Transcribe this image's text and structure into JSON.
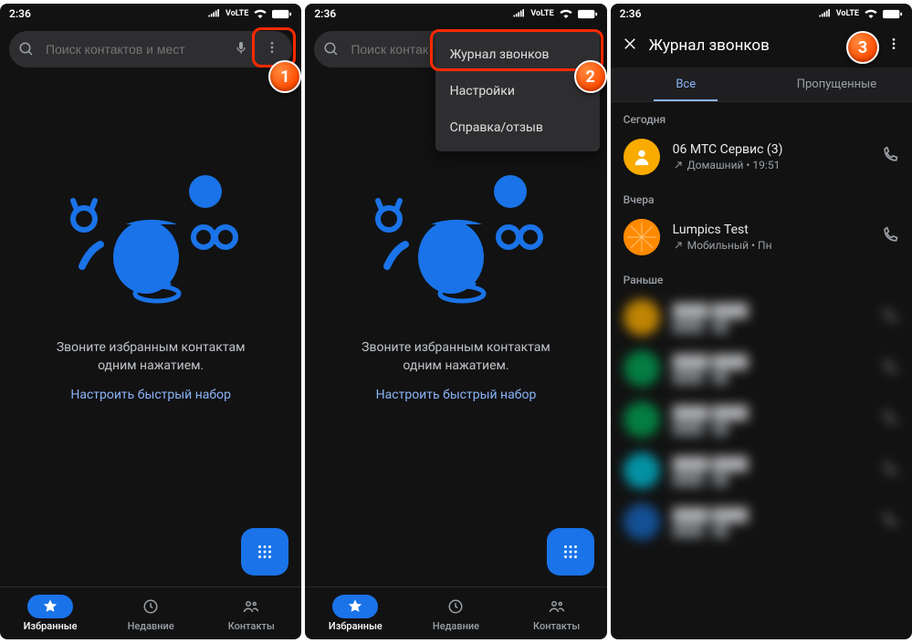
{
  "status": {
    "time": "2:36",
    "volte": "VoLTE"
  },
  "search": {
    "placeholder": "Поиск контактов и мест",
    "placeholder_short": "Поиск контак"
  },
  "empty": {
    "title": "Звоните избранным контактам одним нажатием.",
    "link": "Настроить быстрый набор"
  },
  "nav": {
    "favorites": "Избранные",
    "recent": "Недавние",
    "contacts": "Контакты"
  },
  "menu": {
    "call_log": "Журнал звонков",
    "settings": "Настройки",
    "help": "Справка/отзыв"
  },
  "history": {
    "title": "Журнал звонков",
    "tab_all": "Все",
    "tab_missed": "Пропущенные",
    "sections": {
      "today": "Сегодня",
      "yesterday": "Вчера",
      "earlier": "Раньше"
    },
    "calls": [
      {
        "name": "06 MTC Сервис  (3)",
        "sub": "Домашний • 19:51",
        "avatar_color": "#f9ab00",
        "char": ""
      },
      {
        "name": "Lumpics Test",
        "sub": "Мобильный • Пн",
        "avatar_color": "#ff8a00",
        "char": ""
      }
    ],
    "blurred": [
      {
        "avatar_color": "#f9ab00"
      },
      {
        "avatar_color": "#00a152"
      },
      {
        "avatar_color": "#00a152"
      },
      {
        "avatar_color": "#00bcd4"
      },
      {
        "avatar_color": "#1565c0"
      }
    ]
  },
  "markers": {
    "m1": "1",
    "m2": "2",
    "m3": "3"
  }
}
